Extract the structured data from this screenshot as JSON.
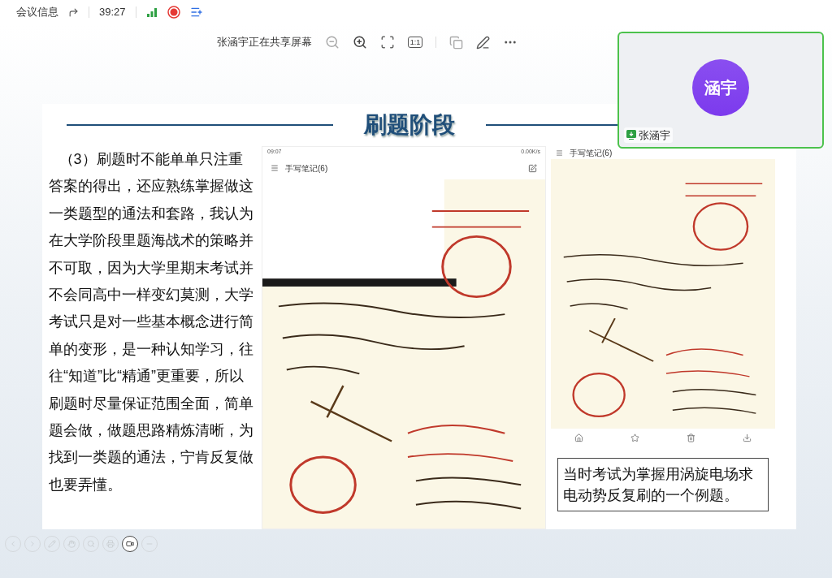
{
  "top_bar": {
    "meeting_info": "会议信息",
    "duration": "39:27",
    "recording": true
  },
  "share_toolbar": {
    "status": "张涵宇正在共享屏幕",
    "scale_label": "1:1"
  },
  "video_tile": {
    "avatar_text": "涵宇",
    "name": "张涵宇",
    "active_speaker": true
  },
  "slide": {
    "title": "刷题阶段",
    "paragraph": "（3）刷题时不能单单只注重答案的得出，还应熟练掌握做这一类题型的通法和套路，我认为在大学阶段里题海战术的策略并不可取，因为大学里期末考试并不会同高中一样变幻莫测，大学考试只是对一些基本概念进行简单的变形，是一种认知学习，往往“知道”比“精通”更重要，所以刷题时尽量保证范围全面，简单题会做，做题思路精炼清晰，为找到一类题的通法，宁肯反复做也要弄懂。",
    "phone_left": {
      "time": "09:07",
      "network": "0.00K/s",
      "app_title": "手写笔记(6)"
    },
    "phone_right": {
      "app_title": "手写笔记(6)"
    },
    "caption": "当时考试为掌握用涡旋电场求电动势反复刷的一个例题。"
  },
  "bottom_tools": [
    {
      "selected": false
    },
    {
      "selected": false
    },
    {
      "selected": false
    },
    {
      "selected": false
    },
    {
      "selected": false
    },
    {
      "selected": false
    },
    {
      "selected": true
    },
    {
      "selected": false
    }
  ]
}
